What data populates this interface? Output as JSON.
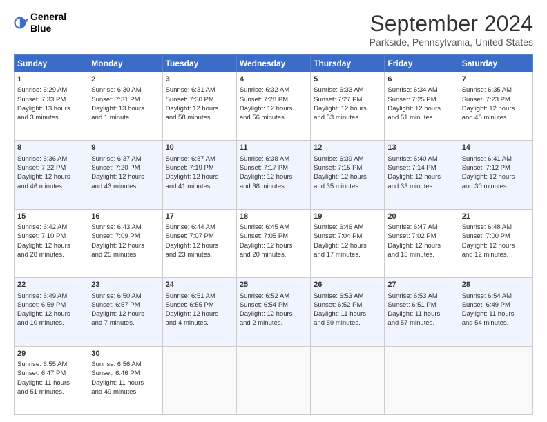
{
  "logo": {
    "line1": "General",
    "line2": "Blue"
  },
  "title": "September 2024",
  "location": "Parkside, Pennsylvania, United States",
  "days_of_week": [
    "Sunday",
    "Monday",
    "Tuesday",
    "Wednesday",
    "Thursday",
    "Friday",
    "Saturday"
  ],
  "weeks": [
    [
      {
        "day": "1",
        "info": "Sunrise: 6:29 AM\nSunset: 7:33 PM\nDaylight: 13 hours\nand 3 minutes."
      },
      {
        "day": "2",
        "info": "Sunrise: 6:30 AM\nSunset: 7:31 PM\nDaylight: 13 hours\nand 1 minute."
      },
      {
        "day": "3",
        "info": "Sunrise: 6:31 AM\nSunset: 7:30 PM\nDaylight: 12 hours\nand 58 minutes."
      },
      {
        "day": "4",
        "info": "Sunrise: 6:32 AM\nSunset: 7:28 PM\nDaylight: 12 hours\nand 56 minutes."
      },
      {
        "day": "5",
        "info": "Sunrise: 6:33 AM\nSunset: 7:27 PM\nDaylight: 12 hours\nand 53 minutes."
      },
      {
        "day": "6",
        "info": "Sunrise: 6:34 AM\nSunset: 7:25 PM\nDaylight: 12 hours\nand 51 minutes."
      },
      {
        "day": "7",
        "info": "Sunrise: 6:35 AM\nSunset: 7:23 PM\nDaylight: 12 hours\nand 48 minutes."
      }
    ],
    [
      {
        "day": "8",
        "info": "Sunrise: 6:36 AM\nSunset: 7:22 PM\nDaylight: 12 hours\nand 46 minutes."
      },
      {
        "day": "9",
        "info": "Sunrise: 6:37 AM\nSunset: 7:20 PM\nDaylight: 12 hours\nand 43 minutes."
      },
      {
        "day": "10",
        "info": "Sunrise: 6:37 AM\nSunset: 7:19 PM\nDaylight: 12 hours\nand 41 minutes."
      },
      {
        "day": "11",
        "info": "Sunrise: 6:38 AM\nSunset: 7:17 PM\nDaylight: 12 hours\nand 38 minutes."
      },
      {
        "day": "12",
        "info": "Sunrise: 6:39 AM\nSunset: 7:15 PM\nDaylight: 12 hours\nand 35 minutes."
      },
      {
        "day": "13",
        "info": "Sunrise: 6:40 AM\nSunset: 7:14 PM\nDaylight: 12 hours\nand 33 minutes."
      },
      {
        "day": "14",
        "info": "Sunrise: 6:41 AM\nSunset: 7:12 PM\nDaylight: 12 hours\nand 30 minutes."
      }
    ],
    [
      {
        "day": "15",
        "info": "Sunrise: 6:42 AM\nSunset: 7:10 PM\nDaylight: 12 hours\nand 28 minutes."
      },
      {
        "day": "16",
        "info": "Sunrise: 6:43 AM\nSunset: 7:09 PM\nDaylight: 12 hours\nand 25 minutes."
      },
      {
        "day": "17",
        "info": "Sunrise: 6:44 AM\nSunset: 7:07 PM\nDaylight: 12 hours\nand 23 minutes."
      },
      {
        "day": "18",
        "info": "Sunrise: 6:45 AM\nSunset: 7:05 PM\nDaylight: 12 hours\nand 20 minutes."
      },
      {
        "day": "19",
        "info": "Sunrise: 6:46 AM\nSunset: 7:04 PM\nDaylight: 12 hours\nand 17 minutes."
      },
      {
        "day": "20",
        "info": "Sunrise: 6:47 AM\nSunset: 7:02 PM\nDaylight: 12 hours\nand 15 minutes."
      },
      {
        "day": "21",
        "info": "Sunrise: 6:48 AM\nSunset: 7:00 PM\nDaylight: 12 hours\nand 12 minutes."
      }
    ],
    [
      {
        "day": "22",
        "info": "Sunrise: 6:49 AM\nSunset: 6:59 PM\nDaylight: 12 hours\nand 10 minutes."
      },
      {
        "day": "23",
        "info": "Sunrise: 6:50 AM\nSunset: 6:57 PM\nDaylight: 12 hours\nand 7 minutes."
      },
      {
        "day": "24",
        "info": "Sunrise: 6:51 AM\nSunset: 6:55 PM\nDaylight: 12 hours\nand 4 minutes."
      },
      {
        "day": "25",
        "info": "Sunrise: 6:52 AM\nSunset: 6:54 PM\nDaylight: 12 hours\nand 2 minutes."
      },
      {
        "day": "26",
        "info": "Sunrise: 6:53 AM\nSunset: 6:52 PM\nDaylight: 11 hours\nand 59 minutes."
      },
      {
        "day": "27",
        "info": "Sunrise: 6:53 AM\nSunset: 6:51 PM\nDaylight: 11 hours\nand 57 minutes."
      },
      {
        "day": "28",
        "info": "Sunrise: 6:54 AM\nSunset: 6:49 PM\nDaylight: 11 hours\nand 54 minutes."
      }
    ],
    [
      {
        "day": "29",
        "info": "Sunrise: 6:55 AM\nSunset: 6:47 PM\nDaylight: 11 hours\nand 51 minutes."
      },
      {
        "day": "30",
        "info": "Sunrise: 6:56 AM\nSunset: 6:46 PM\nDaylight: 11 hours\nand 49 minutes."
      },
      {
        "day": "",
        "info": ""
      },
      {
        "day": "",
        "info": ""
      },
      {
        "day": "",
        "info": ""
      },
      {
        "day": "",
        "info": ""
      },
      {
        "day": "",
        "info": ""
      }
    ]
  ]
}
